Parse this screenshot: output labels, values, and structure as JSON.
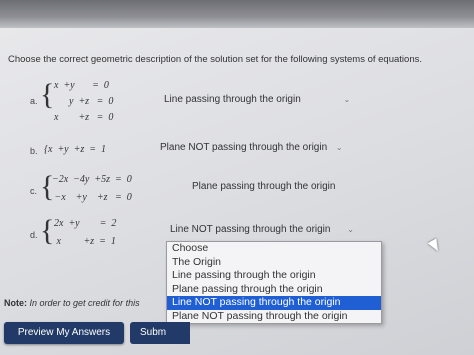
{
  "question": "Choose the correct geometric description of the solution set for the following systems of equations.",
  "systems": [
    {
      "label": "a.",
      "rows": [
        "x  +y       =  0",
        "      y  +z   =  0",
        "x        +z   =  0"
      ],
      "selected": "Line passing through the origin"
    },
    {
      "label": "b.",
      "rows": [
        "{x  +y  +z  =  1"
      ],
      "selected": "Plane NOT passing through the origin"
    },
    {
      "label": "c.",
      "rows": [
        "−2x  −4y  +5z  =  0",
        " −x    +y    +z   =  0"
      ],
      "selected": "Plane passing through the origin"
    },
    {
      "label": "d.",
      "rows": [
        "2x  +y        =  2",
        " x         +z  =  1"
      ],
      "selected": "Line NOT passing through the origin"
    }
  ],
  "dropdown_options": [
    "Choose",
    "The Origin",
    "Line passing through the origin",
    "Plane passing through the origin",
    "Line NOT passing through the origin",
    "Plane NOT passing through the origin"
  ],
  "highlighted_option_index": 4,
  "note": {
    "bold": "Note:",
    "text": "In order to get credit for this"
  },
  "buttons": {
    "preview": "Preview My Answers",
    "submit": "Subm"
  },
  "icons": {
    "dropdown": "chevron-down-icon"
  }
}
